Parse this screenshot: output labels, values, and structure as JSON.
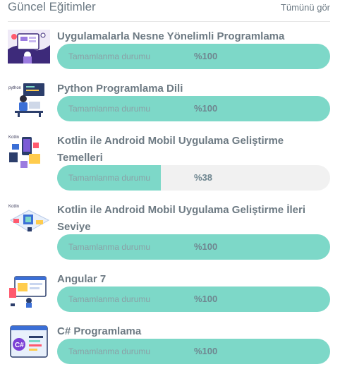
{
  "header": {
    "title": "Güncel Eğitimler",
    "see_all": "Tümünü gör"
  },
  "courses": [
    {
      "title": "Uygulamalarla Nesne Yönelimli Programlama",
      "progress_label": "Tamamlanma durumu",
      "progress_text": "%100",
      "progress": 100
    },
    {
      "title": "Python Programlama Dili",
      "progress_label": "Tamamlanma durumu",
      "progress_text": "%100",
      "progress": 100
    },
    {
      "title": "Kotlin ile Android Mobil Uygulama Geliştirme Temelleri",
      "progress_label": "Tamamlanma durumu",
      "progress_text": "%38",
      "progress": 38
    },
    {
      "title": "Kotlin ile Android Mobil Uygulama Geliştirme İleri Seviye",
      "progress_label": "Tamamlanma durumu",
      "progress_text": "%100",
      "progress": 100
    },
    {
      "title": "Angular 7",
      "progress_label": "Tamamlanma durumu",
      "progress_text": "%100",
      "progress": 100
    },
    {
      "title": "C# Programlama",
      "progress_label": "Tamamlanma durumu",
      "progress_text": "%100",
      "progress": 100
    }
  ],
  "thumb_texts": {
    "python": "python",
    "kotlin1": "Kotlin",
    "kotlin2": "Kotlin",
    "csharp": "C#"
  },
  "colors": {
    "accent": "#7dd8c8",
    "track": "#f1f1f1",
    "text": "#6d7a83"
  }
}
